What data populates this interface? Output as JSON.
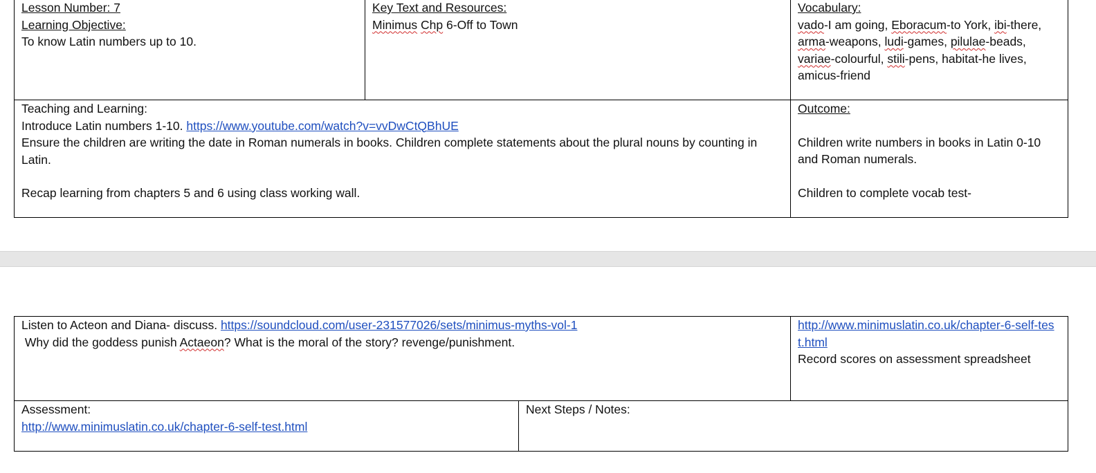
{
  "table1": {
    "lesson_number": "Lesson Number: 7",
    "objective_label": "Learning Objective:",
    "objective_text": "To know Latin numbers up to 10.",
    "key_text_label": "Key Text and Resources:",
    "key_text_minimus": "Minimus",
    "key_text_chp": "Chp",
    "key_text_rest": " 6-Off to Town",
    "vocab_label": "Vocabulary:",
    "vocab": {
      "w1": "vado",
      "t1": "-I am going, ",
      "w2": "Eboracum",
      "t2": "-to York, ",
      "w3": "ibi",
      "t3": "-there,",
      "w4": "arma",
      "t4": "-weapons, ",
      "w5": "ludi",
      "t5": "-games, ",
      "w6": "pilulae",
      "t6": "-beads,",
      "w7": "variae",
      "t7": "-colourful, ",
      "w8": "stili",
      "t8": "-pens, habitat-he lives,",
      "line4": "amicus-friend"
    },
    "teaching_label": "Teaching and Learning:",
    "teaching_intro": "Introduce Latin numbers 1-10. ",
    "teaching_link": "https://www.youtube.com/watch?v=vvDwCtQBhUE",
    "teaching_para": "Ensure the children are writing the date in Roman numerals in books. Children complete statements about the plural nouns by counting in Latin.",
    "teaching_recap": "Recap learning from chapters 5 and 6 using class working wall.",
    "outcome_label": "Outcome:",
    "outcome_text1": "Children write numbers in books in Latin 0-10 and Roman numerals.",
    "outcome_text2": "Children to complete vocab test-"
  },
  "table2": {
    "listen_text": "Listen to Acteon and Diana- discuss. ",
    "listen_link": "https://soundcloud.com/user-231577026/sets/minimus-myths-vol-1",
    "question_pre": " Why did the goddess punish ",
    "question_name": "Actaeon",
    "question_post": "? What is the moral of the story? revenge/punishment.",
    "selftest_link": "http://www.minimuslatin.co.uk/chapter-6-self-test.html",
    "record_text": "Record scores on assessment spreadsheet",
    "assessment_label": "Assessment:",
    "assessment_link": "http://www.minimuslatin.co.uk/chapter-6-self-test.html",
    "next_steps_label": "Next Steps / Notes:"
  }
}
